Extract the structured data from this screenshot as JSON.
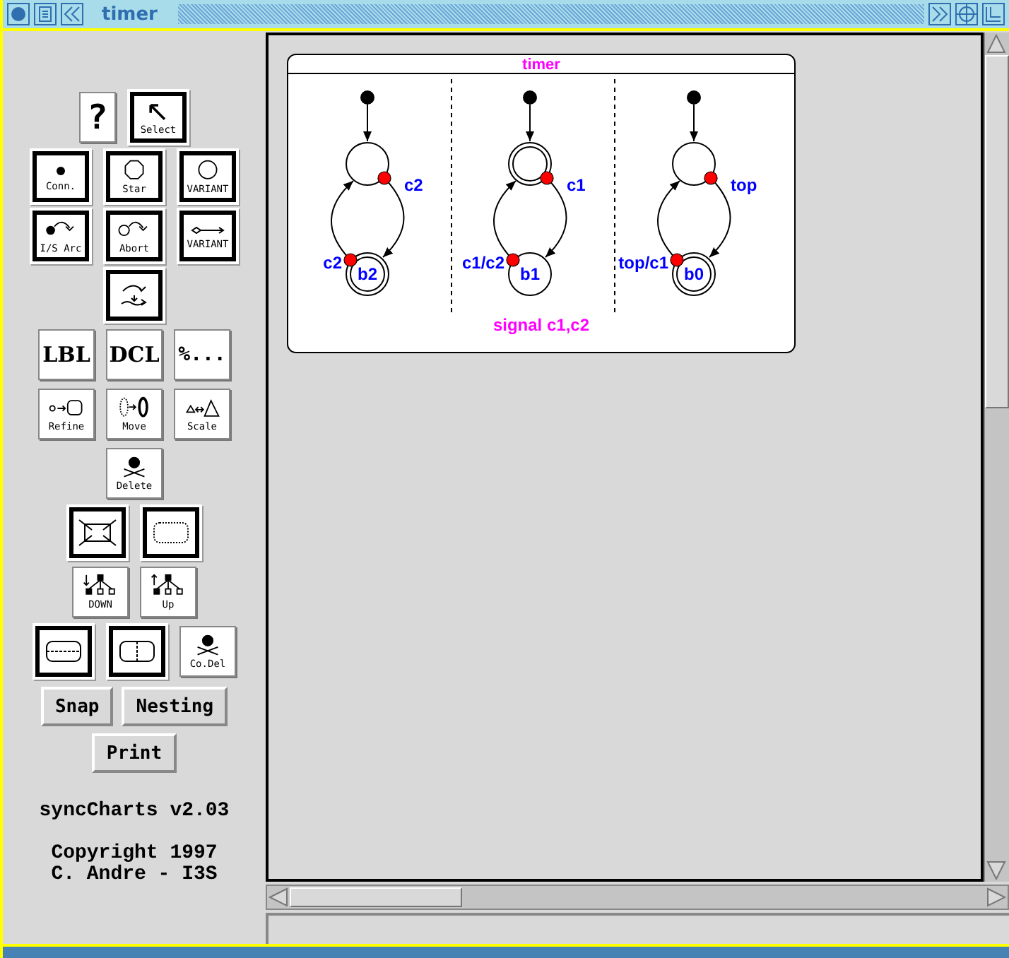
{
  "window": {
    "title": "timer"
  },
  "tools": [
    [
      {
        "kind": "help",
        "label": "?",
        "framed": false
      },
      {
        "kind": "select",
        "label": "Select",
        "framed": true
      }
    ],
    [
      {
        "kind": "connector",
        "label": "Conn.",
        "framed": true
      },
      {
        "kind": "state",
        "label": "Star",
        "framed": true
      },
      {
        "kind": "variant-state",
        "label": "VARIANT",
        "framed": true
      }
    ],
    [
      {
        "kind": "initial-arc",
        "label": "I/S Arc",
        "framed": true
      },
      {
        "kind": "abort-arc",
        "label": "Abort",
        "framed": true
      },
      {
        "kind": "variant-arc",
        "label": "VARIANT",
        "framed": true
      }
    ],
    [
      {
        "kind": "suspend",
        "framed": true
      }
    ],
    [
      {
        "kind": "label",
        "label": "LBL",
        "framed": false
      },
      {
        "kind": "decl",
        "label": "DCL",
        "framed": false
      },
      {
        "kind": "comment",
        "label": "%...",
        "framed": false
      }
    ],
    [
      {
        "kind": "refine",
        "label": "Refine",
        "framed": false
      },
      {
        "kind": "move",
        "label": "Move",
        "framed": false
      },
      {
        "kind": "scale",
        "label": "Scale",
        "framed": false
      }
    ],
    [
      {
        "kind": "delete",
        "label": "Delete",
        "framed": false
      }
    ],
    [
      {
        "kind": "zoom",
        "framed": true
      },
      {
        "kind": "macro",
        "framed": true
      }
    ],
    [
      {
        "kind": "down",
        "label": "DOWN",
        "framed": false
      },
      {
        "kind": "up",
        "label": "Up",
        "framed": false
      }
    ],
    [
      {
        "kind": "hsplit",
        "framed": true
      },
      {
        "kind": "vsplit",
        "framed": true
      },
      {
        "kind": "delete",
        "label": "Co.Del",
        "framed": false
      }
    ]
  ],
  "buttons": [
    [
      "Snap",
      "Nesting"
    ],
    [
      "Print"
    ]
  ],
  "info": [
    "syncCharts v2.03",
    "Copyright 1997",
    "C. Andre - I3S"
  ],
  "diagram": {
    "title": "timer",
    "footer": "signal c1,c2",
    "regions": [
      {
        "states": [
          {
            "final": false
          },
          {
            "label": "b2",
            "final": true
          }
        ],
        "down_label": "c2",
        "up_label": "c2"
      },
      {
        "states": [
          {
            "final": true
          },
          {
            "label": "b1",
            "final": false
          }
        ],
        "down_label": "c1",
        "up_label": "c1/c2"
      },
      {
        "states": [
          {
            "final": false
          },
          {
            "label": "b0",
            "final": true
          }
        ],
        "down_label": "top",
        "up_label": "top/c1"
      }
    ]
  }
}
